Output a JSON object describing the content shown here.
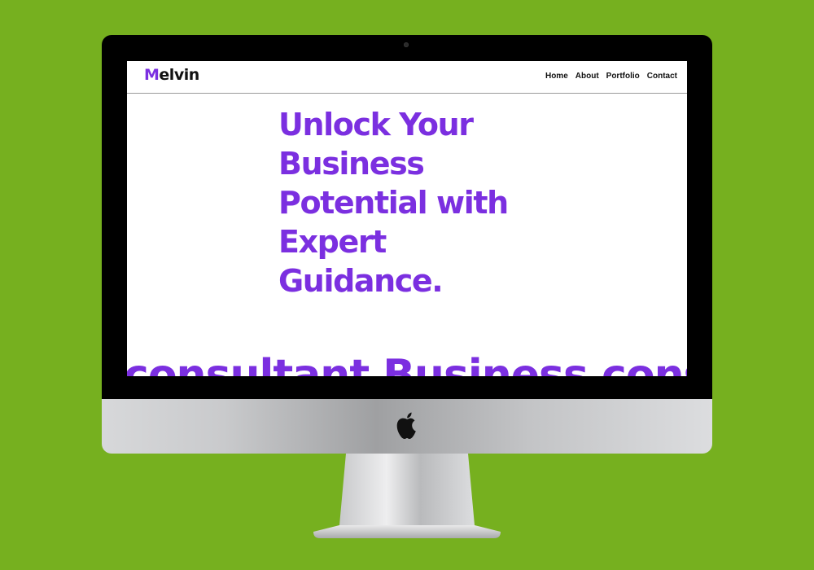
{
  "brand": {
    "initial": "M",
    "rest": "elvin"
  },
  "nav": {
    "items": [
      {
        "label": "Home"
      },
      {
        "label": "About"
      },
      {
        "label": "Portfolio"
      },
      {
        "label": "Contact"
      }
    ]
  },
  "hero": {
    "title": "Unlock Your Business Potential with Expert Guidance."
  },
  "marquee": {
    "text": "consultant Business consultant Business"
  },
  "icons": {
    "device_logo": "apple-icon"
  },
  "colors": {
    "background": "#76b01f",
    "accent": "#7b2fe0",
    "text": "#111111"
  }
}
